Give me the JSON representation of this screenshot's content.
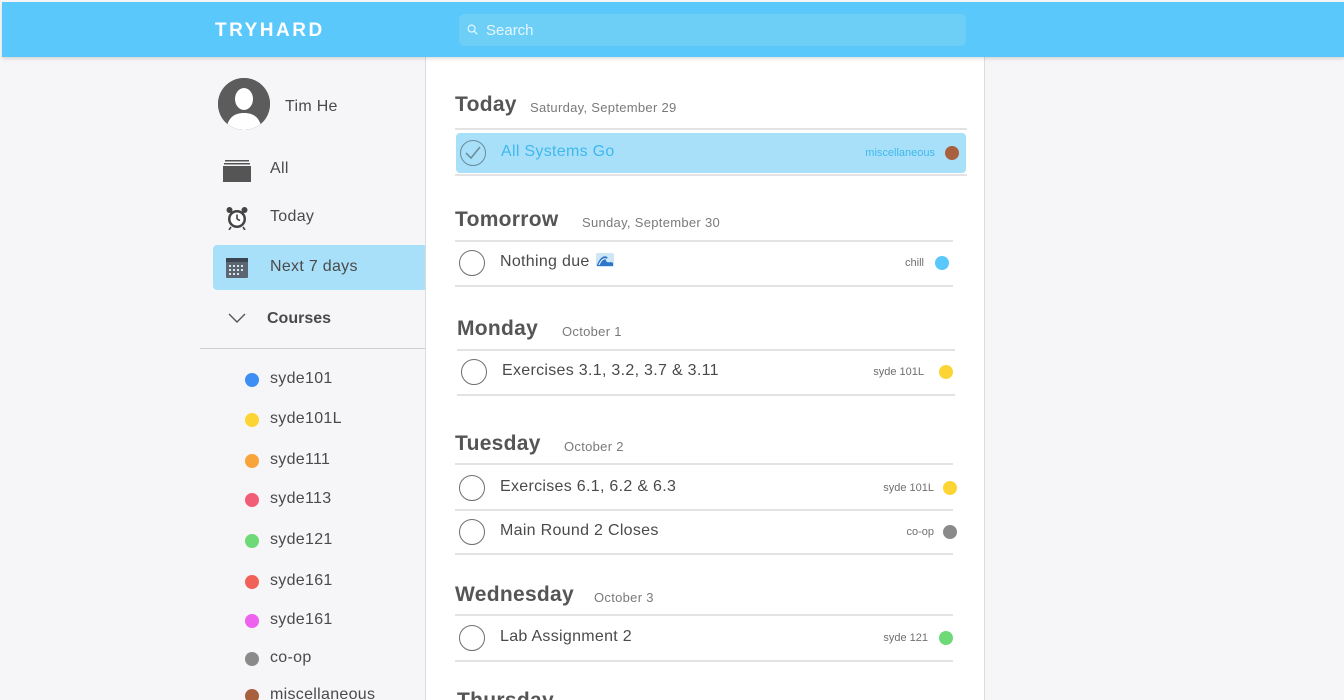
{
  "app": {
    "brand": "TRYHARD",
    "search_placeholder": "Search"
  },
  "user": {
    "name": "Tim He"
  },
  "nav": [
    {
      "label": "All",
      "icon": "stack-icon"
    },
    {
      "label": "Today",
      "icon": "alarm-clock-icon"
    },
    {
      "label": "Next 7 days",
      "icon": "calendar-icon",
      "active": true
    }
  ],
  "courses": {
    "heading": "Courses",
    "items": [
      {
        "name": "syde101",
        "color": "#3d8ff5"
      },
      {
        "name": "syde101L",
        "color": "#fcd535"
      },
      {
        "name": "syde111",
        "color": "#f9a33b"
      },
      {
        "name": "syde113",
        "color": "#f25d75"
      },
      {
        "name": "syde121",
        "color": "#6ed977"
      },
      {
        "name": "syde161",
        "color": "#f26158"
      },
      {
        "name": "syde161",
        "color": "#ee62ee"
      },
      {
        "name": "co-op",
        "color": "#8a8a8a"
      },
      {
        "name": "miscellaneous",
        "color": "#a8603e"
      }
    ]
  },
  "days": [
    {
      "title": "Today",
      "date": "Saturday, September 29",
      "tasks": [
        {
          "name": "All Systems Go",
          "tag": "miscellaneous",
          "color": "#a8603e",
          "completed": true,
          "selected": true
        }
      ]
    },
    {
      "title": "Tomorrow",
      "date": "Sunday, September 30",
      "tasks": [
        {
          "name": "Nothing due",
          "emoji_icon": "wave-icon",
          "tag": "chill",
          "color": "#5ac8fa",
          "completed": false
        }
      ]
    },
    {
      "title": "Monday",
      "date": "October 1",
      "tasks": [
        {
          "name": "Exercises 3.1, 3.2, 3.7 & 3.11",
          "tag": "syde 101L",
          "color": "#fcd535",
          "completed": false
        }
      ]
    },
    {
      "title": "Tuesday",
      "date": "October 2",
      "tasks": [
        {
          "name": "Exercises 6.1, 6.2 & 6.3",
          "tag": "syde 101L",
          "color": "#fcd535",
          "completed": false
        },
        {
          "name": "Main Round 2 Closes",
          "tag": "co-op",
          "color": "#8a8a8a",
          "completed": false
        }
      ]
    },
    {
      "title": "Wednesday",
      "date": "October 3",
      "tasks": [
        {
          "name": "Lab Assignment 2",
          "tag": "syde 121",
          "color": "#6ed977",
          "completed": false
        }
      ]
    },
    {
      "title": "Thursday",
      "date": ""
    }
  ]
}
